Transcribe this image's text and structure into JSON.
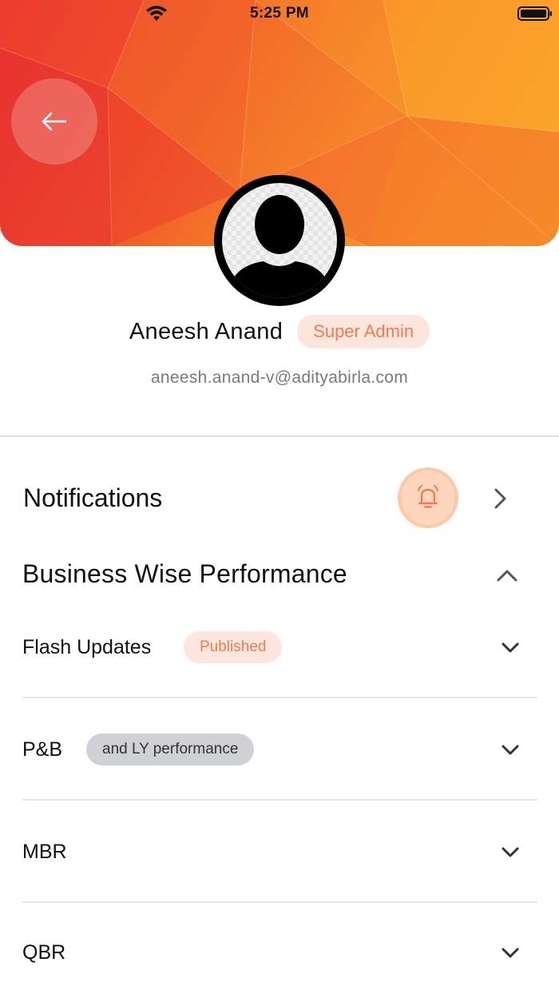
{
  "status_bar": {
    "time": "5:25 PM"
  },
  "header": {
    "back_icon": "arrow-left-icon",
    "avatar_icon": "user-silhouette-icon",
    "accent_color": "#f05a28"
  },
  "profile": {
    "name": "Aneesh Anand",
    "role": "Super Admin",
    "email": "aneesh.anand-v@adityabirla.com"
  },
  "notifications": {
    "title": "Notifications",
    "icon": "bell-icon"
  },
  "business": {
    "title": "Business Wise Performance",
    "items": [
      {
        "label": "Flash Updates",
        "badge": "Published",
        "badge_style": "published"
      },
      {
        "label": "P&B",
        "badge": "and LY performance",
        "badge_style": "grey"
      },
      {
        "label": "MBR",
        "badge": ""
      },
      {
        "label": "QBR",
        "badge": ""
      }
    ]
  }
}
